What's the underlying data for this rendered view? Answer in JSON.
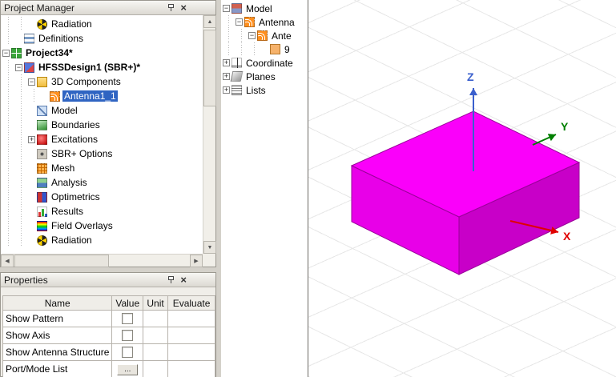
{
  "project_manager": {
    "title": "Project Manager",
    "items": [
      {
        "label": "Radiation",
        "icon": "radiation-icon",
        "depth": 2
      },
      {
        "label": "Definitions",
        "icon": "definitions-icon",
        "depth": 1
      },
      {
        "label": "Project34*",
        "icon": "project-icon",
        "depth": 0,
        "bold": true,
        "expanded": true
      },
      {
        "label": "HFSSDesign1 (SBR+)*",
        "icon": "hfss-design-icon",
        "depth": 1,
        "bold": true,
        "expanded": true
      },
      {
        "label": "3D Components",
        "icon": "folder-icon",
        "depth": 2,
        "expanded": true
      },
      {
        "label": "Antenna1_1",
        "icon": "antenna-component-icon",
        "depth": 3,
        "selected": true
      },
      {
        "label": "Model",
        "icon": "model-icon",
        "depth": 2
      },
      {
        "label": "Boundaries",
        "icon": "boundaries-icon",
        "depth": 2
      },
      {
        "label": "Excitations",
        "icon": "excitations-icon",
        "depth": 2,
        "expanded": false
      },
      {
        "label": "SBR+ Options",
        "icon": "sbr-options-icon",
        "depth": 2
      },
      {
        "label": "Mesh",
        "icon": "mesh-icon",
        "depth": 2
      },
      {
        "label": "Analysis",
        "icon": "analysis-icon",
        "depth": 2
      },
      {
        "label": "Optimetrics",
        "icon": "optimetrics-icon",
        "depth": 2
      },
      {
        "label": "Results",
        "icon": "results-icon",
        "depth": 2
      },
      {
        "label": "Field Overlays",
        "icon": "field-overlays-icon",
        "depth": 2
      },
      {
        "label": "Radiation",
        "icon": "radiation-icon",
        "depth": 2
      }
    ]
  },
  "modeler_tree": {
    "items": [
      {
        "label": "Model",
        "icon": "model-node-icon",
        "depth": 0,
        "expanded": true
      },
      {
        "label": "Antenna",
        "icon": "antenna-icon",
        "depth": 1,
        "expanded": true
      },
      {
        "label": "Ante",
        "icon": "antenna-icon",
        "depth": 2,
        "expanded": true
      },
      {
        "label": "9",
        "icon": "sheet-icon",
        "depth": 3
      },
      {
        "label": "Coordinate",
        "icon": "coordinate-system-icon",
        "depth": 0,
        "expanded": false
      },
      {
        "label": "Planes",
        "icon": "planes-icon",
        "depth": 0,
        "expanded": false
      },
      {
        "label": "Lists",
        "icon": "lists-icon",
        "depth": 0,
        "expanded": false
      }
    ]
  },
  "properties": {
    "title": "Properties",
    "columns": [
      "Name",
      "Value",
      "Unit",
      "Evaluate"
    ],
    "rows": [
      {
        "name": "Show Pattern",
        "control": "checkbox",
        "checked": false
      },
      {
        "name": "Show Axis",
        "control": "checkbox",
        "checked": false
      },
      {
        "name": "Show Antenna Structure",
        "control": "checkbox",
        "checked": false
      },
      {
        "name": "Port/Mode List",
        "control": "button",
        "button_label": "..."
      }
    ]
  },
  "viewport": {
    "axes": {
      "x_label": "X",
      "y_label": "Y",
      "z_label": "Z"
    },
    "colors": {
      "x_axis": "#e00000",
      "y_axis": "#007f00",
      "z_axis": "#3a5fcd",
      "box_top": "#fa00fa",
      "box_left": "#e800e8",
      "box_right": "#c800c8",
      "grid": "#e7e7e7"
    }
  }
}
